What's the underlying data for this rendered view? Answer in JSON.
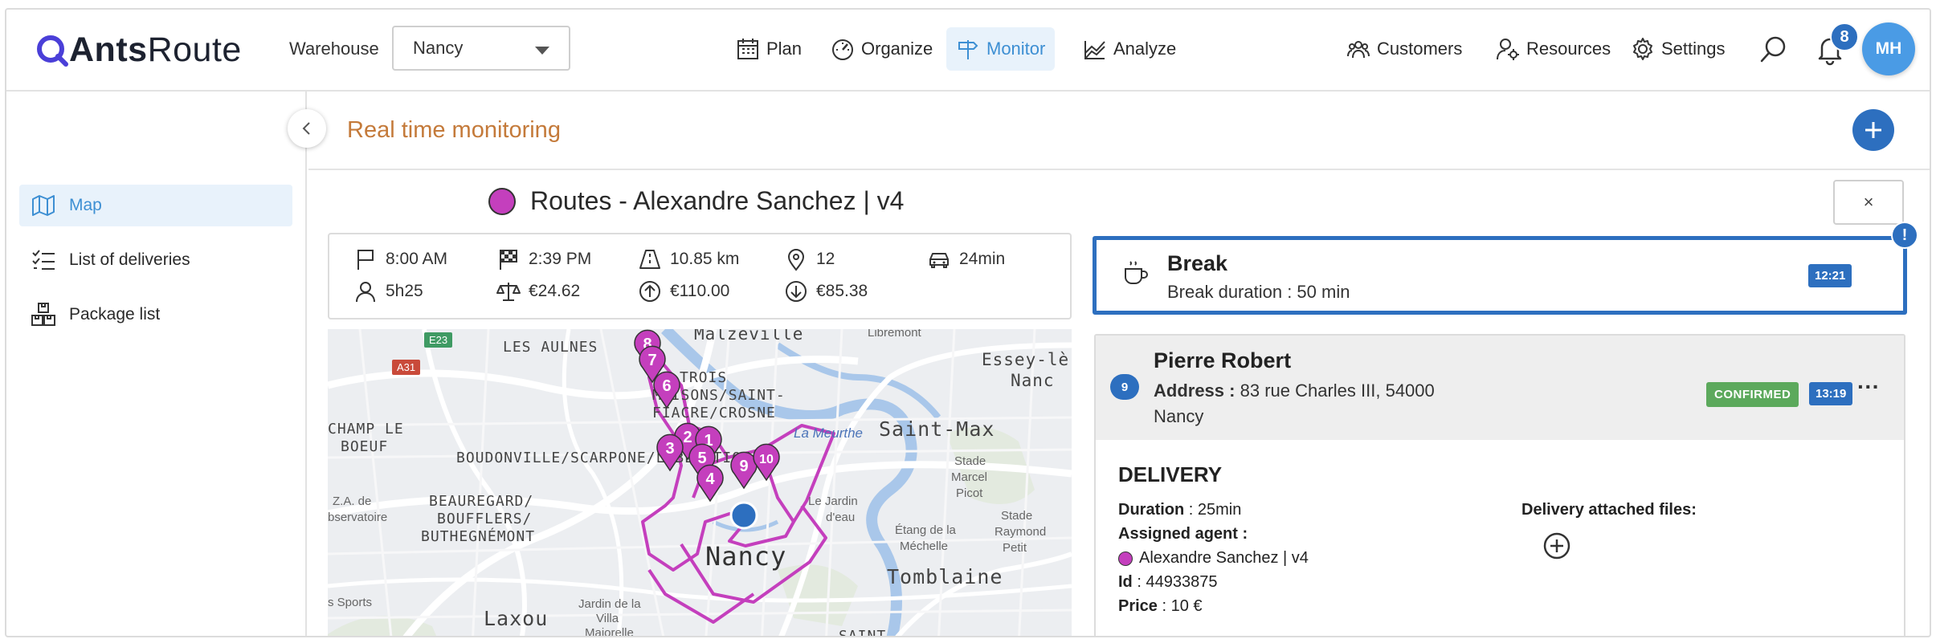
{
  "app": {
    "logo_bold": "Ants",
    "logo_light": "Route"
  },
  "warehouse": {
    "label": "Warehouse",
    "value": "Nancy"
  },
  "nav": {
    "plan": "Plan",
    "organize": "Organize",
    "monitor": "Monitor",
    "analyze": "Analyze",
    "customers": "Customers",
    "resources": "Resources",
    "settings": "Settings"
  },
  "notifications": {
    "count": "8"
  },
  "user": {
    "initials": "MH"
  },
  "sidebar": {
    "items": [
      {
        "label": "Map",
        "icon": "map-icon"
      },
      {
        "label": "List of deliveries",
        "icon": "checklist-icon"
      },
      {
        "label": "Package list",
        "icon": "boxes-icon"
      }
    ]
  },
  "page": {
    "title": "Real time monitoring"
  },
  "route": {
    "title": "Routes - Alexandre Sanchez | v4",
    "color": "#c43fbd",
    "close": "×"
  },
  "stats": {
    "start": "8:00 AM",
    "end": "2:39 PM",
    "distance": "10.85 km",
    "stops": "12",
    "drive": "24min",
    "duration": "5h25",
    "cost": "€24.62",
    "revenue": "€110.00",
    "margin": "€85.38"
  },
  "map": {
    "labels": {
      "malzeville": "Malzéville",
      "aulnes": "LES AULNES",
      "trois1": "TROIS",
      "trois2": "MAISONS/SAINT-",
      "trois3": "FIACRE/CROSNE",
      "essey1": "Essey-lè",
      "essey2": "Nanc",
      "champ1": "CHAMP LE",
      "champ2": "BOEUF",
      "meurthe": "La Meurthe",
      "saintmax": "Saint-Max",
      "boudon": "BOUDONVILLE/SCARPONE/LIBÉRATION",
      "beau1": "BEAUREGARD/",
      "beau2": "BOUFFLERS/",
      "beau3": "BUTHEGNÉMONT",
      "nancy": "Nancy",
      "tomblaine": "Tomblaine",
      "laxou": "Laxou",
      "saint": "SAINT-",
      "libremont": "Libremont",
      "stade1": "Stade",
      "stade2": "Marcel",
      "stade3": "Picot",
      "sr1": "Stade",
      "sr2": "Raymond",
      "sr3": "Petit",
      "jardin1": "Le Jardin",
      "jardin2": "d'eau",
      "etang1": "Étang de la",
      "etang2": "Méchelle",
      "za1": "Z.A. de",
      "za2": "bservatoire",
      "sports": "s Sports",
      "villa1": "Jardin de la",
      "villa2": "Villa",
      "villa3": "Majorelle",
      "e23": "E23",
      "a31": "A31"
    },
    "pins": [
      "8",
      "7",
      "6",
      "2",
      "1",
      "3",
      "5",
      "4",
      "9",
      "10"
    ]
  },
  "break": {
    "title": "Break",
    "detail": "Break duration : 50 min",
    "time": "12:21",
    "alert": "!"
  },
  "stop": {
    "seq": "9",
    "name": "Pierre Robert",
    "address_label": "Address :",
    "address": "83 rue Charles III, 54000",
    "city": "Nancy",
    "status": "CONFIRMED",
    "time": "13:19",
    "more": "···",
    "type": "DELIVERY",
    "duration_label": "Duration",
    "duration": ": 25min",
    "agent_label": "Assigned agent :",
    "agent": "Alexandre Sanchez | v4",
    "id_label": "Id",
    "id": ": 44933875",
    "price_label": "Price",
    "price": ": 10 €",
    "files_label": "Delivery attached files:"
  }
}
